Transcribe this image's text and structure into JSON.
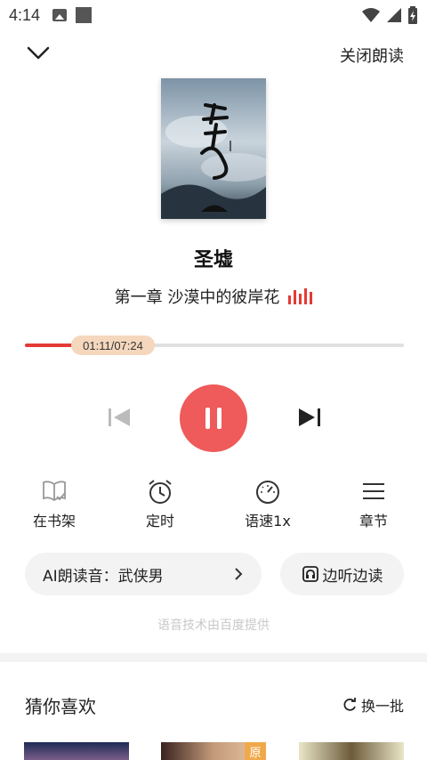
{
  "status_bar": {
    "time": "4:14"
  },
  "header": {
    "close_label": "关闭朗读"
  },
  "book": {
    "title": "圣墟",
    "chapter": "第一章 沙漠中的彼岸花"
  },
  "player": {
    "progress_text": "01:11/07:24",
    "progress_fraction": 0.16
  },
  "tools": [
    {
      "label": "在书架",
      "icon": "bookshelf-check-icon"
    },
    {
      "label": "定时",
      "icon": "alarm-clock-icon"
    },
    {
      "label": "语速1x",
      "icon": "speedometer-icon"
    },
    {
      "label": "章节",
      "icon": "menu-list-icon"
    }
  ],
  "ai_voice": {
    "label": "AI朗读音：武侠男"
  },
  "listen_read": {
    "label": "边听边读"
  },
  "credit": "语音技术由百度提供",
  "recommend": {
    "title": "猜你喜欢",
    "refresh_label": "换一批",
    "badge": "原"
  },
  "colors": {
    "accent": "#ef5a5a",
    "progress": "#e53935",
    "time_pill": "#f5d7bd"
  }
}
